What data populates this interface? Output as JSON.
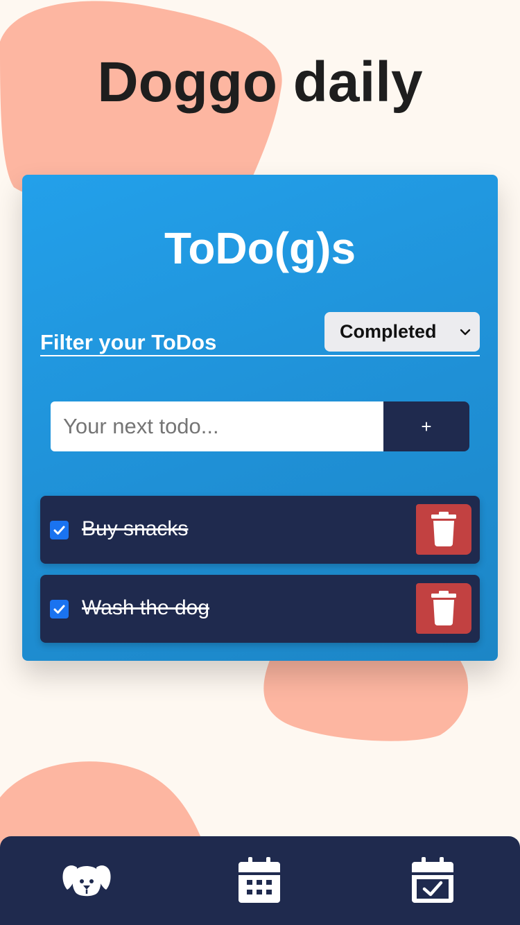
{
  "app": {
    "title": "Doggo daily"
  },
  "todo_card": {
    "title": "ToDo(g)s",
    "filter": {
      "label": "Filter your ToDos",
      "selected": "Completed"
    },
    "input": {
      "placeholder": "Your next todo...",
      "value": ""
    },
    "add_button_label": "+",
    "items": [
      {
        "text": "Buy snacks",
        "completed": true
      },
      {
        "text": "Wash the dog",
        "completed": true
      }
    ]
  },
  "nav": {
    "items": [
      {
        "icon": "dog-icon"
      },
      {
        "icon": "calendar-icon"
      },
      {
        "icon": "calendar-check-icon"
      }
    ]
  },
  "colors": {
    "background": "#fef8f1",
    "blob": "#fdb6a1",
    "card_gradient_start": "#23a0ea",
    "card_gradient_end": "#1c86c6",
    "navy": "#1f2a4e",
    "delete_red": "#c24141",
    "checkbox_blue": "#1a73f0"
  }
}
